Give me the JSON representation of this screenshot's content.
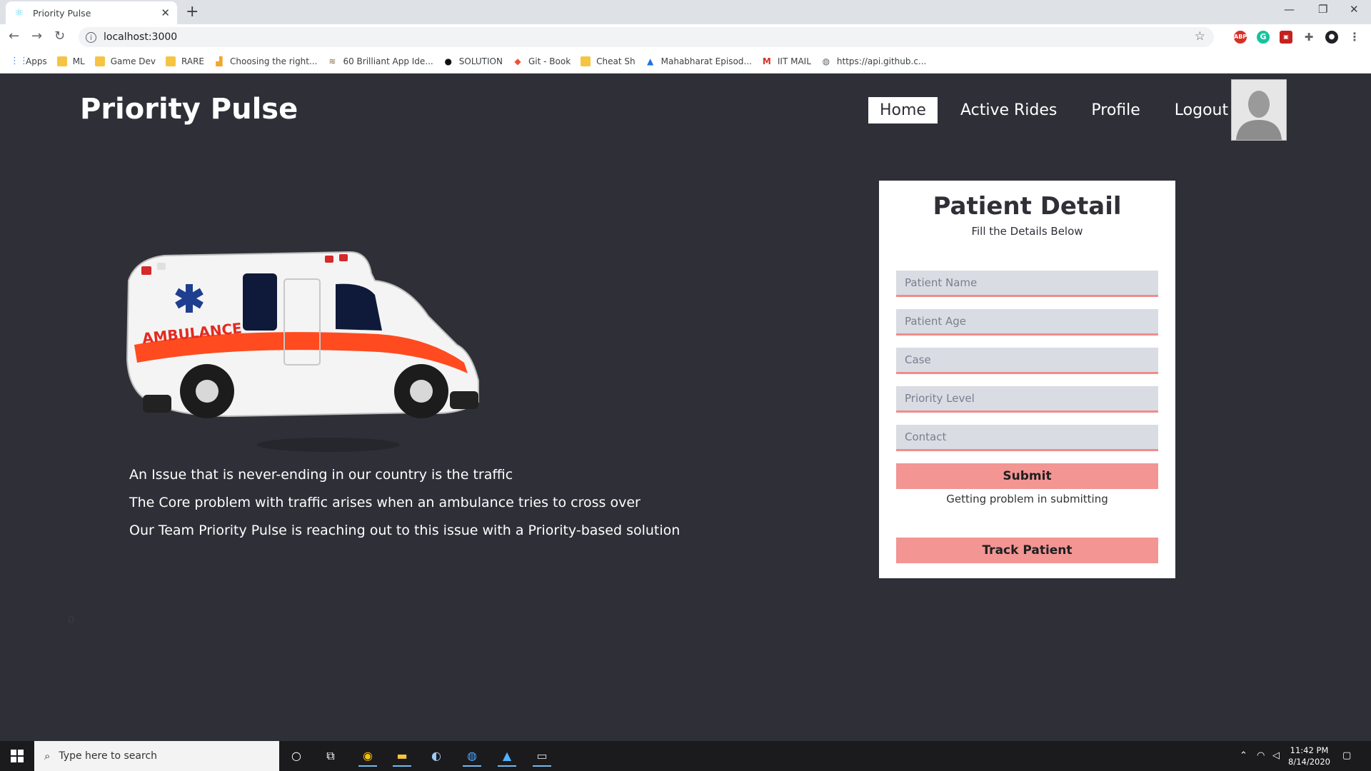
{
  "browser": {
    "tab_title": "Priority Pulse",
    "url": "localhost:3000",
    "bookmarks": [
      {
        "label": "Apps",
        "icon": "apps-grid-icon"
      },
      {
        "label": "ML",
        "icon": "folder-icon"
      },
      {
        "label": "Game Dev",
        "icon": "folder-icon"
      },
      {
        "label": "RARE",
        "icon": "folder-icon"
      },
      {
        "label": "Choosing the right...",
        "icon": "chart-icon"
      },
      {
        "label": "60 Brilliant App Ide...",
        "icon": "coins-icon"
      },
      {
        "label": "SOLUTION",
        "icon": "github-icon"
      },
      {
        "label": "Git - Book",
        "icon": "git-icon"
      },
      {
        "label": "Cheat Sh",
        "icon": "folder-icon"
      },
      {
        "label": "Mahabharat Episod...",
        "icon": "triangle-logo-icon"
      },
      {
        "label": "IIT MAIL",
        "icon": "gmail-icon"
      },
      {
        "label": "https://api.github.c...",
        "icon": "globe-icon"
      }
    ]
  },
  "app": {
    "brand": "Priority Pulse",
    "nav": [
      {
        "label": "Home",
        "active": true
      },
      {
        "label": "Active Rides",
        "active": false
      },
      {
        "label": "Profile",
        "active": false
      },
      {
        "label": "Logout",
        "active": false
      }
    ],
    "ambulance_text": "AMBULANCE",
    "intro_lines": [
      "An Issue that is never-ending in our country is the traffic",
      "The Core problem with traffic arises when an ambulance tries to cross over",
      "Our Team Priority Pulse is reaching out to this issue with a Priority-based solution"
    ],
    "stray_text": "0"
  },
  "form": {
    "title": "Patient Detail",
    "subtitle": "Fill the Details Below",
    "fields": [
      {
        "placeholder": "Patient Name",
        "value": ""
      },
      {
        "placeholder": "Patient Age",
        "value": ""
      },
      {
        "placeholder": "Case",
        "value": ""
      },
      {
        "placeholder": "Priority Level",
        "value": ""
      },
      {
        "placeholder": "Contact",
        "value": ""
      }
    ],
    "submit_label": "Submit",
    "help_text": "Getting problem in submitting",
    "track_label": "Track Patient"
  },
  "taskbar": {
    "search_placeholder": "Type here to search",
    "time": "11:42 PM",
    "date": "8/14/2020"
  },
  "colors": {
    "page_bg": "#2f2f38",
    "accent_pink": "#f29593",
    "field_bg": "#d9dce3",
    "field_border": "#f08c8c"
  }
}
